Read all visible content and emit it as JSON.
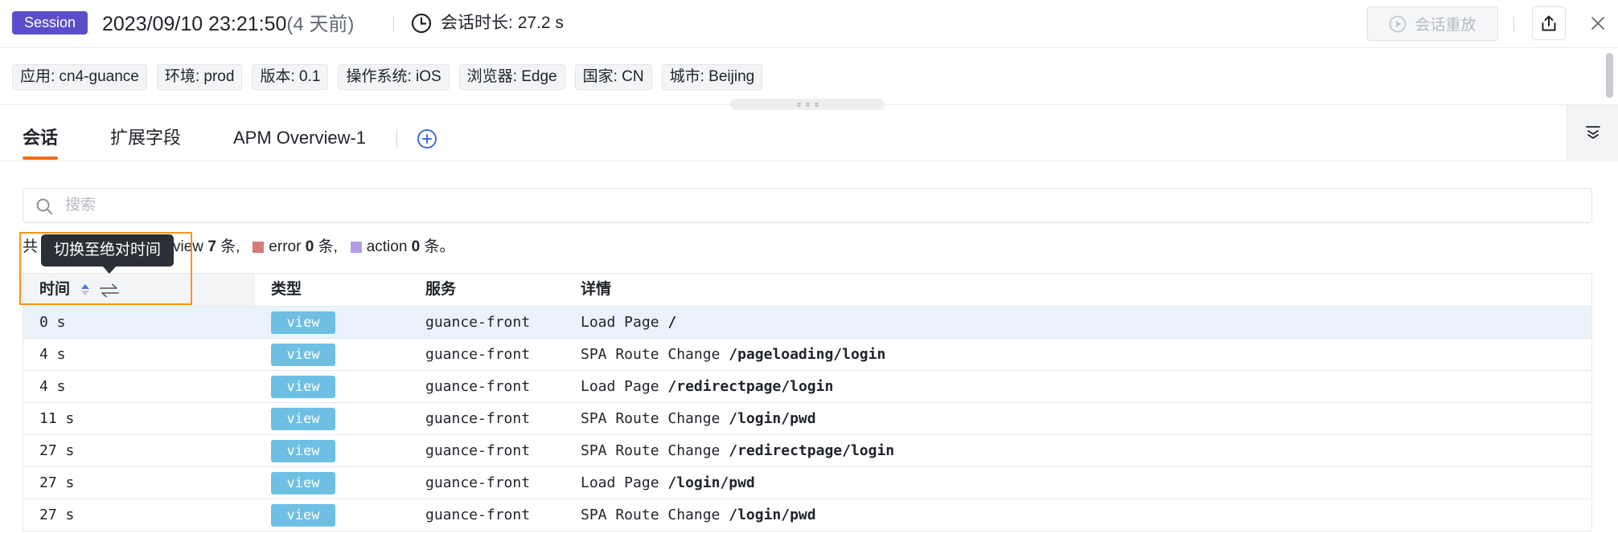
{
  "header": {
    "session_tag": "Session",
    "datetime": "2023/09/10 23:21:50",
    "relative": "(4 天前)",
    "duration_label": "会话时长:",
    "duration_value": "27.2 s",
    "replay_button": "会话重放"
  },
  "tags": [
    "应用: cn4-guance",
    "环境: prod",
    "版本: 0.1",
    "操作系统: iOS",
    "浏览器: Edge",
    "国家: CN",
    "城市: Beijing"
  ],
  "tabs": [
    {
      "label": "会话"
    },
    {
      "label": "扩展字段"
    },
    {
      "label": "APM Overview-1"
    }
  ],
  "search": {
    "placeholder": "搜索"
  },
  "summary": {
    "prefix": "共",
    "view_tail": "view",
    "view_count": "7",
    "unit": "条,",
    "error_label": "error",
    "error_count": "0",
    "action_label": "action",
    "action_count": "0",
    "end_unit": "条。",
    "colors": {
      "view": "#6fbfe3",
      "error": "#d77b78",
      "action": "#b49de8"
    }
  },
  "tooltip": "切换至绝对时间",
  "table": {
    "columns": [
      "时间",
      "类型",
      "服务",
      "详情"
    ],
    "rows": [
      {
        "time": "0 s",
        "type": "view",
        "service": "guance-front",
        "action": "Load Page",
        "path": "/"
      },
      {
        "time": "4 s",
        "type": "view",
        "service": "guance-front",
        "action": "SPA Route Change",
        "path": "/pageloading/login"
      },
      {
        "time": "4 s",
        "type": "view",
        "service": "guance-front",
        "action": "Load Page",
        "path": "/redirectpage/login"
      },
      {
        "time": "11 s",
        "type": "view",
        "service": "guance-front",
        "action": "SPA Route Change",
        "path": "/login/pwd"
      },
      {
        "time": "27 s",
        "type": "view",
        "service": "guance-front",
        "action": "SPA Route Change",
        "path": "/redirectpage/login"
      },
      {
        "time": "27 s",
        "type": "view",
        "service": "guance-front",
        "action": "Load Page",
        "path": "/login/pwd"
      },
      {
        "time": "27 s",
        "type": "view",
        "service": "guance-front",
        "action": "SPA Route Change",
        "path": "/login/pwd"
      }
    ]
  },
  "colors": {
    "accent": "#f76b15",
    "session_tag": "#5b4fc9",
    "view_badge": "#6fbfe3"
  }
}
